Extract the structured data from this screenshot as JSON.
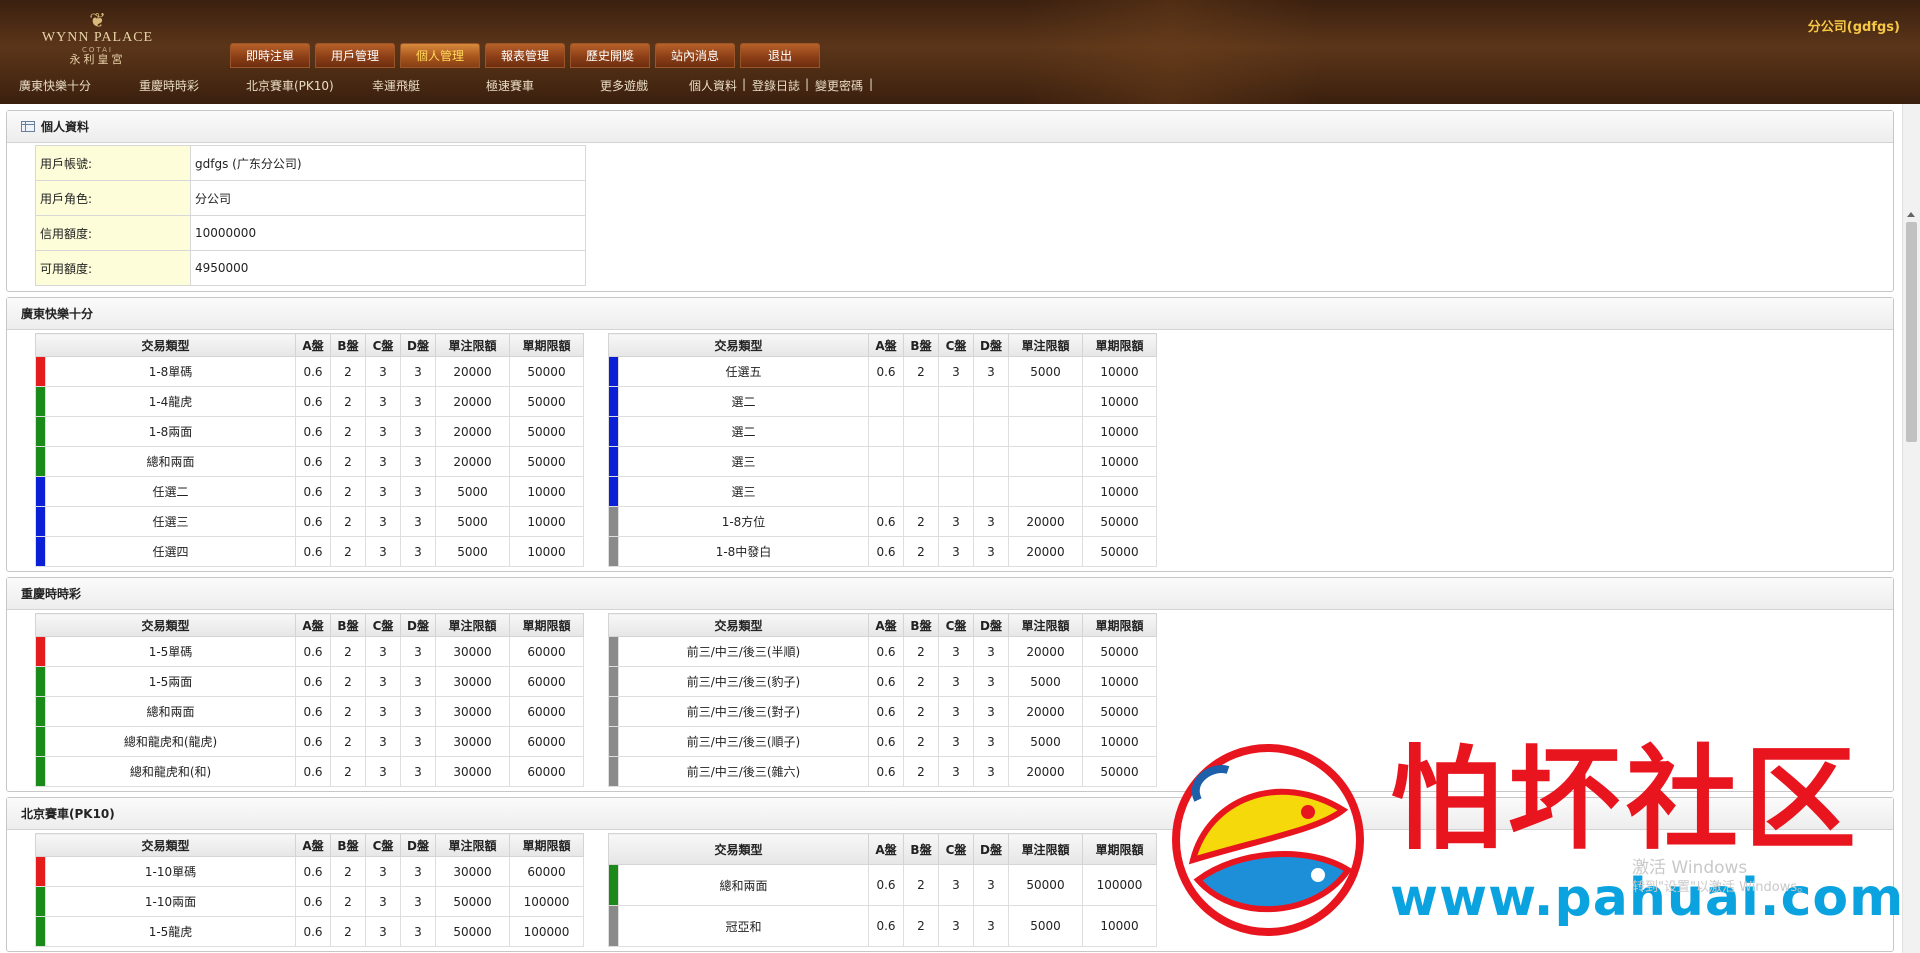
{
  "logo": {
    "main": "WYNN PALACE",
    "sub": "COTAI",
    "cn": "永利皇宮"
  },
  "header": {
    "company": "分公司(gdfgs)"
  },
  "nav": [
    "即時注單",
    "用戶管理",
    "個人管理",
    "報表管理",
    "歷史開獎",
    "站內消息",
    "退出"
  ],
  "subnav": {
    "games": [
      "廣東快樂十分",
      "重慶時時彩",
      "北京賽車(PK10)",
      "幸運飛艇",
      "極速賽車",
      "更多遊戲"
    ],
    "links": [
      "個人資料",
      "登錄日誌",
      "變更密碼"
    ],
    "separator": "|"
  },
  "profile": {
    "title": "個人資料",
    "rows": [
      {
        "label": "用戶帳號:",
        "value": "gdfgs (广东分公司)"
      },
      {
        "label": "用戶角色:",
        "value": "分公司"
      },
      {
        "label": "信用額度:",
        "value": "10000000"
      },
      {
        "label": "可用額度:",
        "value": "4950000"
      }
    ]
  },
  "headers": [
    "交易類型",
    "A盤",
    "B盤",
    "C盤",
    "D盤",
    "單注限額",
    "單期限額"
  ],
  "colors": {
    "red": "#e51c1c",
    "green": "#1a8a1a",
    "blue": "#0b1fd6",
    "gray": "#8a8a8a"
  },
  "sections": [
    {
      "title": "廣東快樂十分",
      "left": [
        {
          "c": "red",
          "v": [
            "1-8單碼",
            "0.6",
            "2",
            "3",
            "3",
            "20000",
            "50000"
          ]
        },
        {
          "c": "green",
          "v": [
            "1-4龍虎",
            "0.6",
            "2",
            "3",
            "3",
            "20000",
            "50000"
          ]
        },
        {
          "c": "green",
          "v": [
            "1-8兩面",
            "0.6",
            "2",
            "3",
            "3",
            "20000",
            "50000"
          ]
        },
        {
          "c": "green",
          "v": [
            "總和兩面",
            "0.6",
            "2",
            "3",
            "3",
            "20000",
            "50000"
          ]
        },
        {
          "c": "blue",
          "v": [
            "任選二",
            "0.6",
            "2",
            "3",
            "3",
            "5000",
            "10000"
          ]
        },
        {
          "c": "blue",
          "v": [
            "任選三",
            "0.6",
            "2",
            "3",
            "3",
            "5000",
            "10000"
          ]
        },
        {
          "c": "blue",
          "v": [
            "任選四",
            "0.6",
            "2",
            "3",
            "3",
            "5000",
            "10000"
          ]
        }
      ],
      "right": [
        {
          "c": "blue",
          "v": [
            "任選五",
            "0.6",
            "2",
            "3",
            "3",
            "5000",
            "10000"
          ]
        },
        {
          "c": "blue",
          "v": [
            "選二",
            "",
            "",
            "",
            "",
            "",
            "10000"
          ]
        },
        {
          "c": "blue",
          "v": [
            "選二",
            "",
            "",
            "",
            "",
            "",
            "10000"
          ]
        },
        {
          "c": "blue",
          "v": [
            "選三",
            "",
            "",
            "",
            "",
            "",
            "10000"
          ]
        },
        {
          "c": "blue",
          "v": [
            "選三",
            "",
            "",
            "",
            "",
            "",
            "10000"
          ]
        },
        {
          "c": "gray",
          "v": [
            "1-8方位",
            "0.6",
            "2",
            "3",
            "3",
            "20000",
            "50000"
          ]
        },
        {
          "c": "gray",
          "v": [
            "1-8中發白",
            "0.6",
            "2",
            "3",
            "3",
            "20000",
            "50000"
          ]
        }
      ]
    },
    {
      "title": "重慶時時彩",
      "left": [
        {
          "c": "red",
          "v": [
            "1-5單碼",
            "0.6",
            "2",
            "3",
            "3",
            "30000",
            "60000"
          ]
        },
        {
          "c": "green",
          "v": [
            "1-5兩面",
            "0.6",
            "2",
            "3",
            "3",
            "30000",
            "60000"
          ]
        },
        {
          "c": "green",
          "v": [
            "總和兩面",
            "0.6",
            "2",
            "3",
            "3",
            "30000",
            "60000"
          ]
        },
        {
          "c": "green",
          "v": [
            "總和龍虎和(龍虎)",
            "0.6",
            "2",
            "3",
            "3",
            "30000",
            "60000"
          ]
        },
        {
          "c": "green",
          "v": [
            "總和龍虎和(和)",
            "0.6",
            "2",
            "3",
            "3",
            "30000",
            "60000"
          ]
        }
      ],
      "right": [
        {
          "c": "gray",
          "v": [
            "前三/中三/後三(半順)",
            "0.6",
            "2",
            "3",
            "3",
            "20000",
            "50000"
          ]
        },
        {
          "c": "gray",
          "v": [
            "前三/中三/後三(豹子)",
            "0.6",
            "2",
            "3",
            "3",
            "5000",
            "10000"
          ]
        },
        {
          "c": "gray",
          "v": [
            "前三/中三/後三(對子)",
            "0.6",
            "2",
            "3",
            "3",
            "20000",
            "50000"
          ]
        },
        {
          "c": "gray",
          "v": [
            "前三/中三/後三(順子)",
            "0.6",
            "2",
            "3",
            "3",
            "5000",
            "10000"
          ]
        },
        {
          "c": "gray",
          "v": [
            "前三/中三/後三(雜六)",
            "0.6",
            "2",
            "3",
            "3",
            "20000",
            "50000"
          ]
        }
      ]
    },
    {
      "title": "北京賽車(PK10)",
      "left": [
        {
          "c": "red",
          "v": [
            "1-10單碼",
            "0.6",
            "2",
            "3",
            "3",
            "30000",
            "60000"
          ]
        },
        {
          "c": "green",
          "v": [
            "1-10兩面",
            "0.6",
            "2",
            "3",
            "3",
            "50000",
            "100000"
          ]
        },
        {
          "c": "green",
          "v": [
            "1-5龍虎",
            "0.6",
            "2",
            "3",
            "3",
            "50000",
            "100000"
          ]
        }
      ],
      "right": [
        {
          "c": "green",
          "v": [
            "總和兩面",
            "0.6",
            "2",
            "3",
            "3",
            "50000",
            "100000"
          ]
        },
        {
          "c": "gray",
          "v": [
            "冠亞和",
            "0.6",
            "2",
            "3",
            "3",
            "5000",
            "10000"
          ]
        }
      ]
    }
  ],
  "watermark": {
    "text": "怕坏社区",
    "url": "www.pahuai.com"
  },
  "windows_activation": {
    "line1": "激活 Windows",
    "line2": "转到\"设置\"以激活 Windows。"
  }
}
